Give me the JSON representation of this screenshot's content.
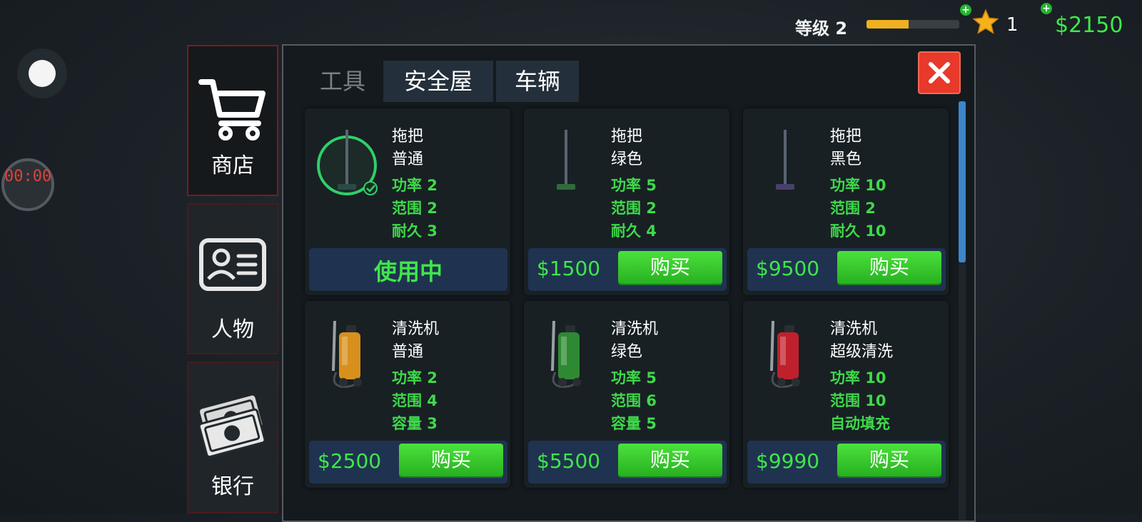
{
  "hud": {
    "level_label": "等级 2",
    "level_progress": 0.45,
    "star_count": "1",
    "money": "$2150",
    "plus": "+"
  },
  "timer": {
    "text": "00:00"
  },
  "nav": [
    {
      "label": "商店",
      "icon": "cart-icon",
      "active": true
    },
    {
      "label": "人物",
      "icon": "id-card-icon",
      "active": false
    },
    {
      "label": "银行",
      "icon": "cash-icon",
      "active": false
    }
  ],
  "tabs": [
    {
      "label": "工具",
      "active": true
    },
    {
      "label": "安全屋",
      "active": false
    },
    {
      "label": "车辆",
      "active": false
    }
  ],
  "items": [
    {
      "name": "拖把",
      "variant": "普通",
      "stats": [
        "功率 2",
        "范围 2",
        "耐久 3"
      ],
      "price": "",
      "action": "使用中",
      "equipped": true,
      "color": "#2a4a44"
    },
    {
      "name": "拖把",
      "variant": "绿色",
      "stats": [
        "功率 5",
        "范围 2",
        "耐久 4"
      ],
      "price": "$1500",
      "action": "购买",
      "equipped": false,
      "color": "#2f6b3a"
    },
    {
      "name": "拖把",
      "variant": "黑色",
      "stats": [
        "功率 10",
        "范围 2",
        "耐久 10"
      ],
      "price": "$9500",
      "action": "购买",
      "equipped": false,
      "color": "#4a3f6b"
    },
    {
      "name": "清洗机",
      "variant": "普通",
      "stats": [
        "功率 2",
        "范围 4",
        "容量 3"
      ],
      "price": "$2500",
      "action": "购买",
      "equipped": false,
      "color": "#d8901c"
    },
    {
      "name": "清洗机",
      "variant": "绿色",
      "stats": [
        "功率 5",
        "范围 6",
        "容量 5"
      ],
      "price": "$5500",
      "action": "购买",
      "equipped": false,
      "color": "#2e8a32"
    },
    {
      "name": "清洗机",
      "variant": "超级清洗",
      "stats": [
        "功率 10",
        "范围 10",
        "自动填充"
      ],
      "price": "$9990",
      "action": "购买",
      "equipped": false,
      "color": "#c0202c"
    }
  ]
}
